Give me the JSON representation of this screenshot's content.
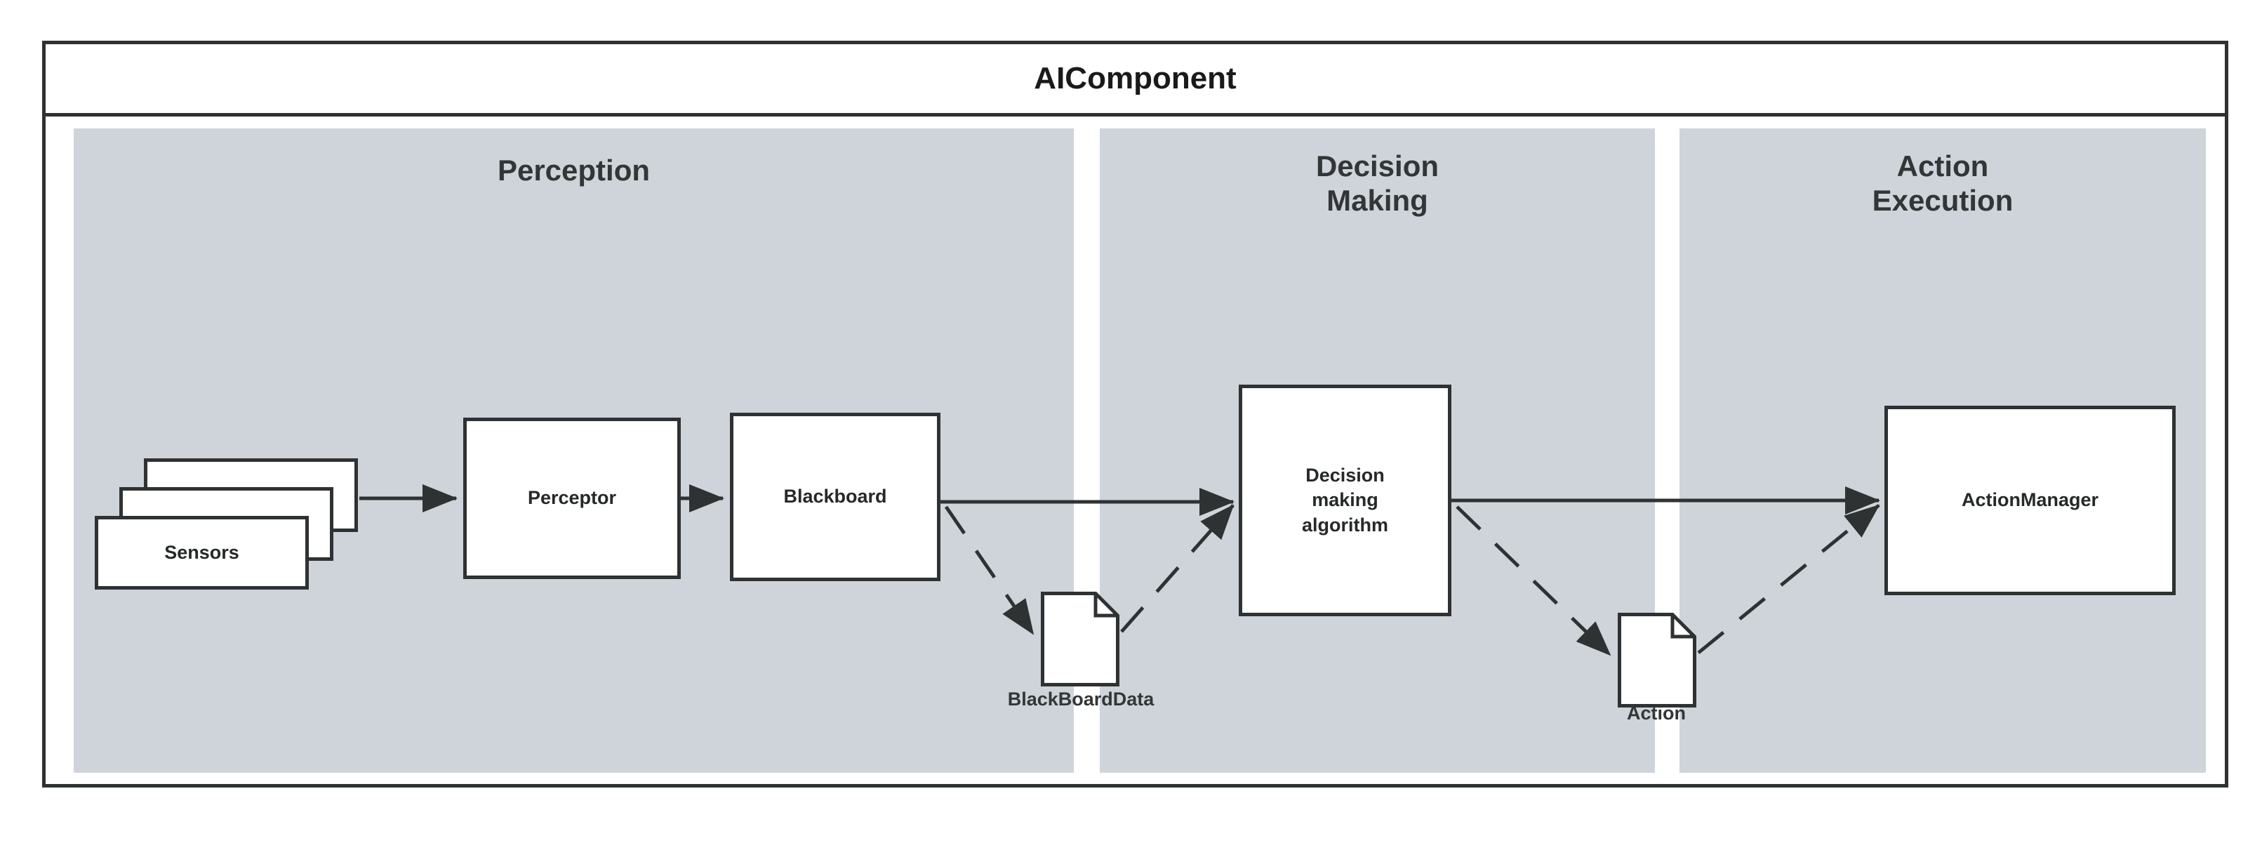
{
  "component": {
    "title": "AIComponent"
  },
  "lanes": [
    {
      "id": "perception",
      "title": "Perception"
    },
    {
      "id": "decision_making",
      "title": "Decision\nMaking"
    },
    {
      "id": "action_execution",
      "title": "Action\nExecution"
    }
  ],
  "nodes": [
    {
      "id": "sensors",
      "label": "Sensors",
      "type": "stacked-box",
      "lane": "perception"
    },
    {
      "id": "perceptor",
      "label": "Perceptor",
      "type": "box",
      "lane": "perception"
    },
    {
      "id": "blackboard",
      "label": "Blackboard",
      "type": "box",
      "lane": "perception"
    },
    {
      "id": "blackboarddata",
      "label": "BlackBoardData",
      "type": "document",
      "lane": "perception"
    },
    {
      "id": "decision_making_algorithm",
      "label": "Decision\nmaking\nalgorithm",
      "type": "box",
      "lane": "decision_making"
    },
    {
      "id": "action",
      "label": "Action",
      "type": "document",
      "lane": "decision_making"
    },
    {
      "id": "action_manager",
      "label": "ActionManager",
      "type": "box",
      "lane": "action_execution"
    }
  ],
  "connectors": [
    {
      "id": "sensors-to-perceptor",
      "from": "sensors",
      "to": "perceptor",
      "style": "solid",
      "arrow": "filled"
    },
    {
      "id": "perceptor-to-blackboard",
      "from": "perceptor",
      "to": "blackboard",
      "style": "solid",
      "arrow": "filled"
    },
    {
      "id": "blackboard-to-decision",
      "from": "blackboard",
      "to": "decision_making_algorithm",
      "style": "solid",
      "arrow": "filled"
    },
    {
      "id": "decision-to-actionmanager",
      "from": "decision_making_algorithm",
      "to": "action_manager",
      "style": "solid",
      "arrow": "filled"
    },
    {
      "id": "blackboard-to-blackboarddata",
      "from": "blackboard",
      "to": "blackboarddata",
      "style": "dashed",
      "arrow": "filled"
    },
    {
      "id": "blackboarddata-to-decision",
      "from": "blackboarddata",
      "to": "decision_making_algorithm",
      "style": "dashed",
      "arrow": "filled"
    },
    {
      "id": "decision-to-action",
      "from": "decision_making_algorithm",
      "to": "action",
      "style": "dashed",
      "arrow": "filled"
    },
    {
      "id": "action-to-actionmanager",
      "from": "action",
      "to": "action_manager",
      "style": "dashed",
      "arrow": "filled"
    }
  ],
  "colors": {
    "lane_background": "#ced4da",
    "stroke": "#2f3232",
    "node_fill": "#ffffff",
    "page_background": "#ffffff",
    "text": "#262929"
  }
}
